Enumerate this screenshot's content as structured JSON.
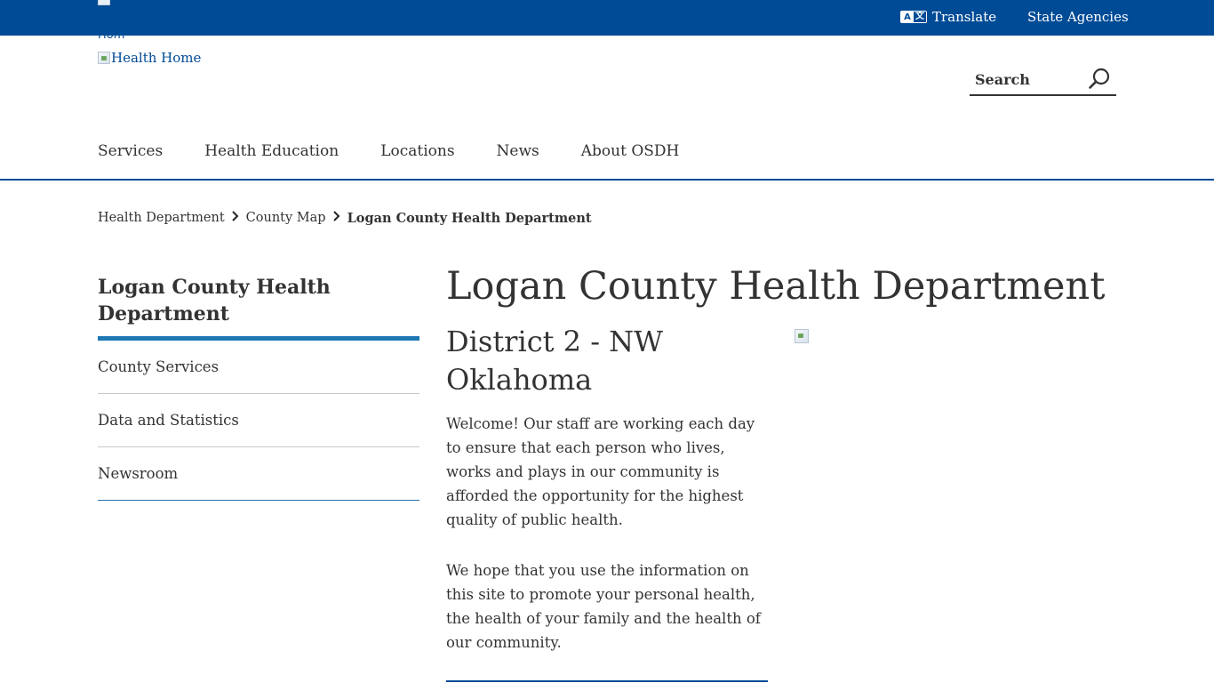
{
  "topbar": {
    "translate_label": "Translate",
    "translate_icon_left": "A",
    "translate_icon_right": "文",
    "state_agencies_label": "State Agencies"
  },
  "logo": {
    "small_alt_text": "Hom",
    "home_alt_text": "Health Home"
  },
  "search": {
    "placeholder": "Search"
  },
  "nav": {
    "items": [
      "Services",
      "Health Education",
      "Locations",
      "News",
      "About OSDH"
    ]
  },
  "breadcrumb": {
    "items": [
      "Health Department",
      "County Map"
    ],
    "current": "Logan County Health Department"
  },
  "sidebar": {
    "title": "Logan County Health Department",
    "items": [
      "County Services",
      "Data and Statistics",
      "Newsroom"
    ]
  },
  "main": {
    "title": "Logan County Health Department",
    "subtitle": "District 2 - NW Oklahoma",
    "paragraphs": [
      "Welcome! Our staff are working each day to ensure that each person who lives, works and plays in our community is afforded the opportunity for the highest quality of public health.",
      "We hope that you use the information on this site to promote your personal health, the health of your family and the health of our community."
    ]
  },
  "colors": {
    "brand_blue": "#004b96",
    "accent_blue": "#1f77b4",
    "text": "#333333"
  }
}
